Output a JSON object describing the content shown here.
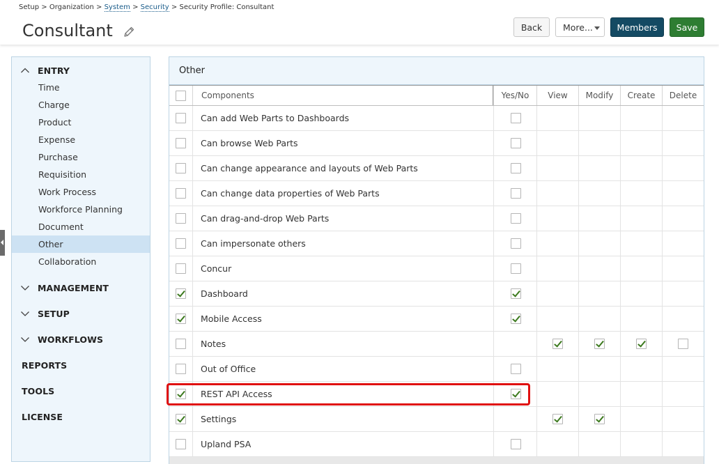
{
  "breadcrumb": {
    "setup": "Setup",
    "sep1": ">",
    "organization": "Organization",
    "sep2": ">",
    "system": "System",
    "sep3": ">",
    "security": "Security",
    "sep4": ">",
    "current": "Security Profile: Consultant"
  },
  "page": {
    "title": "Consultant"
  },
  "toolbar": {
    "back_label": "Back",
    "more_label": "More...",
    "members_label": "Members",
    "save_label": "Save"
  },
  "sidebar": {
    "sections": [
      {
        "label": "ENTRY",
        "expanded": true,
        "items": [
          "Time",
          "Charge",
          "Product",
          "Expense",
          "Purchase",
          "Requisition",
          "Work Process",
          "Workforce Planning",
          "Document",
          "Other",
          "Collaboration"
        ],
        "active": "Other"
      },
      {
        "label": "MANAGEMENT",
        "expanded": false
      },
      {
        "label": "SETUP",
        "expanded": false
      },
      {
        "label": "WORKFLOWS",
        "expanded": false
      },
      {
        "label": "REPORTS"
      },
      {
        "label": "TOOLS"
      },
      {
        "label": "LICENSE"
      }
    ]
  },
  "panel": {
    "title": "Other",
    "columns": [
      "Components",
      "Yes/No",
      "View",
      "Modify",
      "Create",
      "Delete"
    ],
    "rows": [
      {
        "name": "Can add Web Parts to Dashboards",
        "select": false,
        "yesno": false
      },
      {
        "name": "Can browse Web Parts",
        "select": false,
        "yesno": false
      },
      {
        "name": "Can change appearance and layouts of Web Parts",
        "select": false,
        "yesno": false
      },
      {
        "name": "Can change data properties of Web Parts",
        "select": false,
        "yesno": false
      },
      {
        "name": "Can drag-and-drop Web Parts",
        "select": false,
        "yesno": false
      },
      {
        "name": "Can impersonate others",
        "select": false,
        "yesno": false
      },
      {
        "name": "Concur",
        "select": false,
        "yesno": false
      },
      {
        "name": "Dashboard",
        "select": true,
        "yesno": true
      },
      {
        "name": "Mobile Access",
        "select": true,
        "yesno": true
      },
      {
        "name": "Notes",
        "select": false,
        "view": true,
        "modify": true,
        "create": true,
        "delete": false
      },
      {
        "name": "Out of Office",
        "select": false,
        "yesno": false
      },
      {
        "name": "REST API Access",
        "select": true,
        "yesno": true,
        "highlighted": true
      },
      {
        "name": "Settings",
        "select": true,
        "view": true,
        "modify": true
      },
      {
        "name": "Upland PSA",
        "select": false,
        "yesno": false
      }
    ]
  },
  "colors": {
    "members_button": "#144a63",
    "save_button": "#2e7d32",
    "highlight": "#e01010",
    "check": "#3d7a1f",
    "sidebar_bg": "#eef6fc",
    "active_item": "#cde2f3"
  }
}
